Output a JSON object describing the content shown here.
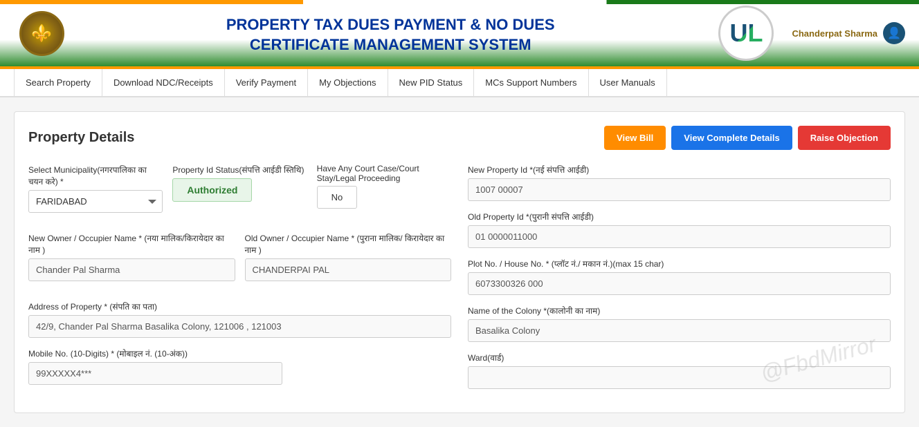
{
  "header": {
    "title_line1": "PROPERTY TAX DUES PAYMENT & NO DUES",
    "title_line2": "CERTIFICATE MANAGEMENT SYSTEM",
    "user_name": "Chanderpat Sharma"
  },
  "nav": {
    "items": [
      {
        "label": "Search Property",
        "id": "search-property"
      },
      {
        "label": "Download NDC/Receipts",
        "id": "download-ndc"
      },
      {
        "label": "Verify Payment",
        "id": "verify-payment"
      },
      {
        "label": "My Objections",
        "id": "my-objections"
      },
      {
        "label": "New PID Status",
        "id": "new-pid-status"
      },
      {
        "label": "MCs Support Numbers",
        "id": "mcs-support"
      },
      {
        "label": "User Manuals",
        "id": "user-manuals"
      }
    ]
  },
  "page": {
    "title": "Property Details",
    "buttons": {
      "view_bill": "View Bill",
      "view_complete_details": "View Complete Details",
      "raise_objection": "Raise Objection"
    }
  },
  "form": {
    "municipality_label": "Select Municipality(नगरपालिका का चयन करे) *",
    "municipality_value": "FARIDABAD",
    "pid_status_label": "Property Id Status(संपत्ति आईडी स्तिथि)",
    "pid_status_value": "Authorized",
    "court_case_label": "Have Any Court Case/Court Stay/Legal Proceeding",
    "court_case_value": "No",
    "new_property_id_label": "New Property Id *(नई संपत्ति आईडी)",
    "new_property_id_value": "1007 00007",
    "old_property_id_label": "Old Property Id *(पुरानी संपत्ति आईडी)",
    "old_property_id_value": "01 0000011000",
    "new_owner_label": "New Owner / Occupier Name * (नया मालिक/किरायेदार का नाम )",
    "new_owner_value": "Chander Pal Sharma",
    "old_owner_label": "Old Owner / Occupier Name * (पुराना मालिक/ किरायेदार का नाम )",
    "old_owner_value": "CHANDERPAI PAL",
    "plot_no_label": "Plot No. / House No. * (प्लॉट नं./ मकान नं.)(max 15 char)",
    "plot_no_value": "6073300326 000",
    "colony_label": "Name of the Colony *(कालोनी का नाम)",
    "colony_value": "Basalika Colony",
    "address_label": "Address of Property * (संपति का पता)",
    "address_value": "42/9, Chander Pal Sharma Basalika Colony, 121006 , 121003",
    "mobile_label": "Mobile No. (10-Digits) * (मोबाइल नं. (10-अंक))",
    "mobile_value": "99XXXXX4***",
    "ward_label": "Ward(वार्ड)"
  }
}
